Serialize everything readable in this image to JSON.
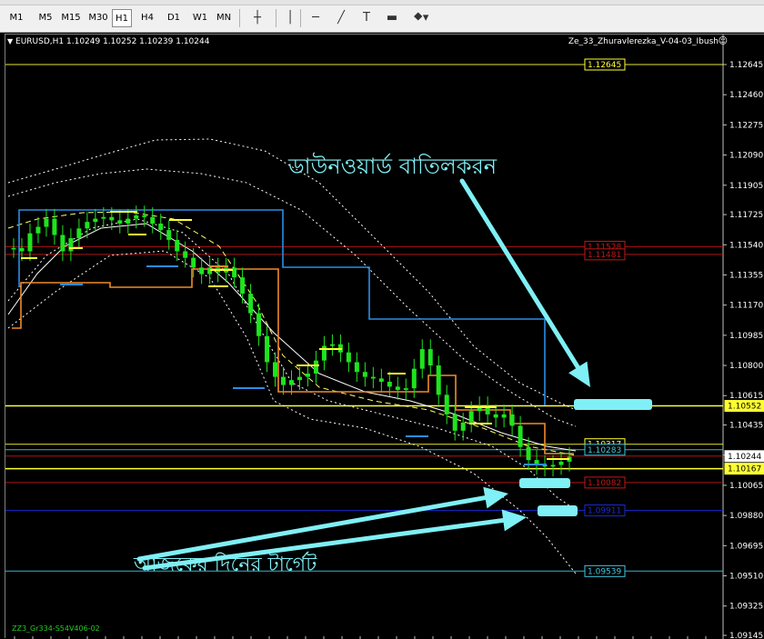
{
  "toolbar": {
    "timeframes": [
      {
        "label": "M1",
        "active": false
      },
      {
        "label": "M5",
        "active": false
      },
      {
        "label": "M15",
        "active": false
      },
      {
        "label": "M30",
        "active": false
      },
      {
        "label": "H1",
        "active": true
      },
      {
        "label": "H4",
        "active": false
      },
      {
        "label": "D1",
        "active": false
      },
      {
        "label": "W1",
        "active": false
      },
      {
        "label": "MN",
        "active": false
      }
    ],
    "tools": [
      {
        "icon": "crosshair-icon"
      },
      {
        "icon": "vertical-line-icon"
      },
      {
        "icon": "horizontal-line-icon"
      },
      {
        "icon": "trendline-icon"
      },
      {
        "icon": "text-icon"
      },
      {
        "icon": "label-icon"
      },
      {
        "icon": "shapes-dropdown-icon"
      }
    ]
  },
  "chart": {
    "symbol_info": "EURUSD,H1  1.10249 1.10252 1.10239 1.10244",
    "indicator_name": "Ze_33_Zhuravlerezka_V-04-03_Ibush",
    "footer_label": "ZZ3_Gr334-S54V406-02",
    "annotation_top": "ডাউনওয়ার্ড বাতিলকরন",
    "annotation_bottom": "আজকের দিনের টার্গেট",
    "colors": {
      "background": "#000000",
      "candle": "#1ee41e",
      "blue_line": "#2b8ee6",
      "orange_line": "#f08a2c",
      "yellow": "#ffff33",
      "red_level": "#c01818",
      "blue_level": "#1a2ad0",
      "cyan_level": "#40c8e0",
      "arrow": "#7ff0f5",
      "annotation": "#7ff0f5"
    }
  },
  "chart_data": {
    "type": "candlestick",
    "symbol": "EURUSD",
    "timeframe": "H1",
    "ohlc": {
      "open": 1.10249,
      "high": 1.10252,
      "low": 1.10239,
      "close": 1.10244
    },
    "y_ticks": [
      "1.12645",
      "1.12460",
      "1.12275",
      "1.12090",
      "1.11905",
      "1.11725",
      "1.11540",
      "1.11355",
      "1.11170",
      "1.10985",
      "1.10800",
      "1.10615",
      "1.10435",
      "1.10250",
      "1.10065",
      "1.09880",
      "1.09695",
      "1.09510",
      "1.09325",
      "1.09145"
    ],
    "ylim": [
      1.09145,
      1.127
    ],
    "price_levels": [
      {
        "label": "1.12645",
        "value": 1.12645,
        "color": "#ffff33"
      },
      {
        "label": "1.11528",
        "value": 1.11528,
        "color": "#c01818"
      },
      {
        "label": "1.11481",
        "value": 1.11481,
        "color": "#c01818"
      },
      {
        "label": "1.10552",
        "value": 1.10552,
        "color": "#ffff33"
      },
      {
        "label": "1.10317",
        "value": 1.10317,
        "color": "#ffff33"
      },
      {
        "label": "1.10283",
        "value": 1.10283,
        "color": "#40c8e0"
      },
      {
        "label": "1.10244",
        "value": 1.10244,
        "color": "#c01818"
      },
      {
        "label": "1.10167",
        "value": 1.10167,
        "color": "#ffff33"
      },
      {
        "label": "1.10082",
        "value": 1.10082,
        "color": "#c01818"
      },
      {
        "label": "1.09911",
        "value": 1.09911,
        "color": "#1a2ad0"
      },
      {
        "label": "1.09539",
        "value": 1.09539,
        "color": "#40c8e0"
      }
    ],
    "closes": [
      1.1152,
      1.115,
      1.1161,
      1.1165,
      1.117,
      1.116,
      1.115,
      1.1158,
      1.1164,
      1.1168,
      1.117,
      1.1171,
      1.1169,
      1.1167,
      1.117,
      1.1172,
      1.1171,
      1.1167,
      1.1163,
      1.1157,
      1.115,
      1.1146,
      1.114,
      1.1136,
      1.114,
      1.1137,
      1.114,
      1.1134,
      1.1124,
      1.1112,
      1.1098,
      1.1082,
      1.1073,
      1.1068,
      1.1071,
      1.1073,
      1.1075,
      1.1083,
      1.1092,
      1.1093,
      1.1088,
      1.1082,
      1.1076,
      1.1073,
      1.1072,
      1.107,
      1.1067,
      1.1065,
      1.1066,
      1.1078,
      1.109,
      1.108,
      1.1062,
      1.105,
      1.104,
      1.1045,
      1.1052,
      1.1055,
      1.105,
      1.1048,
      1.105,
      1.1043,
      1.103,
      1.1022,
      1.1019,
      1.1018,
      1.1019,
      1.1021,
      1.1024
    ]
  }
}
